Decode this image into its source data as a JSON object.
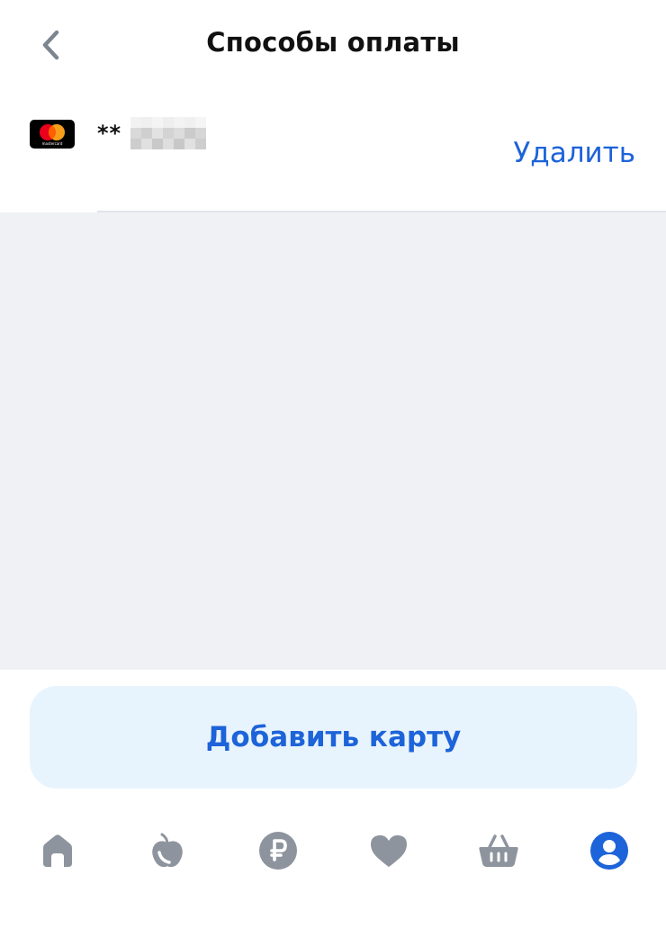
{
  "header": {
    "title": "Способы оплаты",
    "back_icon": "chevron-left-icon"
  },
  "card": {
    "brand_logo_text": "mastercard",
    "masked_prefix": "**",
    "delete_label": "Удалить"
  },
  "add_card": {
    "label": "Добавить карту"
  },
  "bottom_nav": {
    "items": [
      {
        "icon": "home-icon",
        "active": false
      },
      {
        "icon": "apple-icon",
        "active": false
      },
      {
        "icon": "ruble-icon",
        "active": false
      },
      {
        "icon": "heart-icon",
        "active": false
      },
      {
        "icon": "basket-icon",
        "active": false
      },
      {
        "icon": "profile-icon",
        "active": true
      }
    ]
  },
  "colors": {
    "accent": "#1d63d9",
    "inactive_icon": "#8e949e",
    "background_gray": "#eff1f5",
    "button_bg": "#e8f4fd"
  }
}
